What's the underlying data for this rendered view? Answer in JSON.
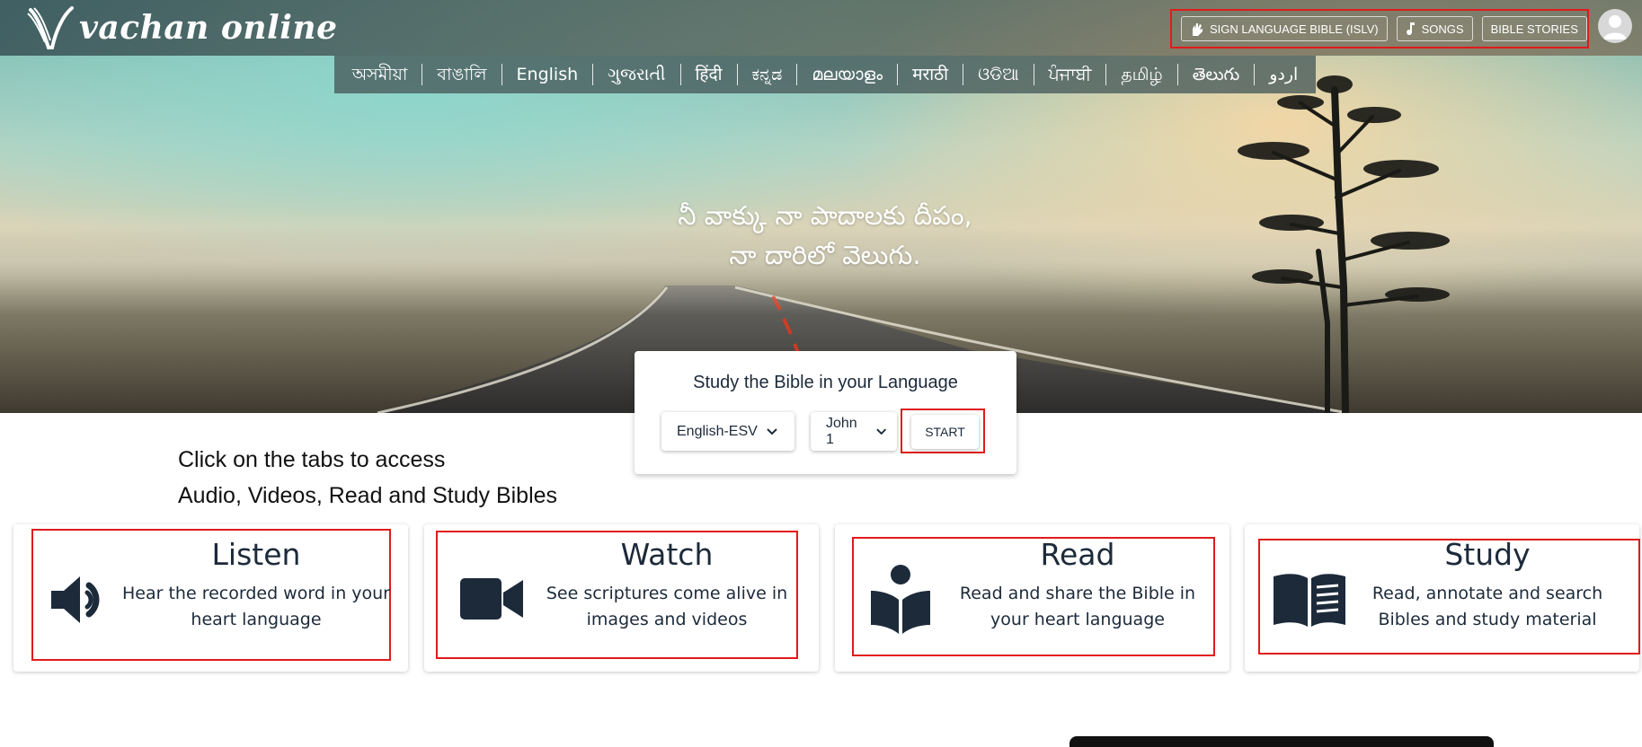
{
  "app": {
    "logo_text": "vachan online"
  },
  "top_nav": {
    "sign_language": "SIGN LANGUAGE BIBLE (ISLV)",
    "songs": "SONGS",
    "bible_stories": "BIBLE STORIES"
  },
  "languages": [
    "অসমীয়া",
    "বাঙালি",
    "English",
    "ગુજરાતી",
    "हिंदी",
    "ಕನ್ನಡ",
    "മലയാളം",
    "मराठी",
    "ଓଡିଆ",
    "ਪੰਜਾਬੀ",
    "தமிழ்",
    "తెలుగు",
    "اردو"
  ],
  "hero": {
    "verse_line1": "నీ వాక్కు నా పాదాలకు దీపం,",
    "verse_line2": "నా దారిలో వెలుగు."
  },
  "study": {
    "title": "Study the Bible in your Language",
    "bible_select": "English-ESV",
    "chapter_select": "John 1",
    "start_label": "START"
  },
  "helper": {
    "line1": "Click on the tabs to access",
    "line2": "Audio, Videos, Read and Study Bibles"
  },
  "features": [
    {
      "title": "Listen",
      "desc_line1": "Hear the recorded word in your",
      "desc_line2": "heart language",
      "icon": "speaker-icon"
    },
    {
      "title": "Watch",
      "desc_line1": "See scriptures come alive in",
      "desc_line2": "images and videos",
      "icon": "video-camera-icon"
    },
    {
      "title": "Read",
      "desc_line1": "Read and share the Bible in",
      "desc_line2": "your heart language",
      "icon": "reader-icon"
    },
    {
      "title": "Study",
      "desc_line1": "Read, annotate and search",
      "desc_line2": "Bibles and study material",
      "icon": "open-book-icon"
    }
  ],
  "colors": {
    "accent_red": "#e01b1b",
    "ink": "#1c2a3a"
  }
}
